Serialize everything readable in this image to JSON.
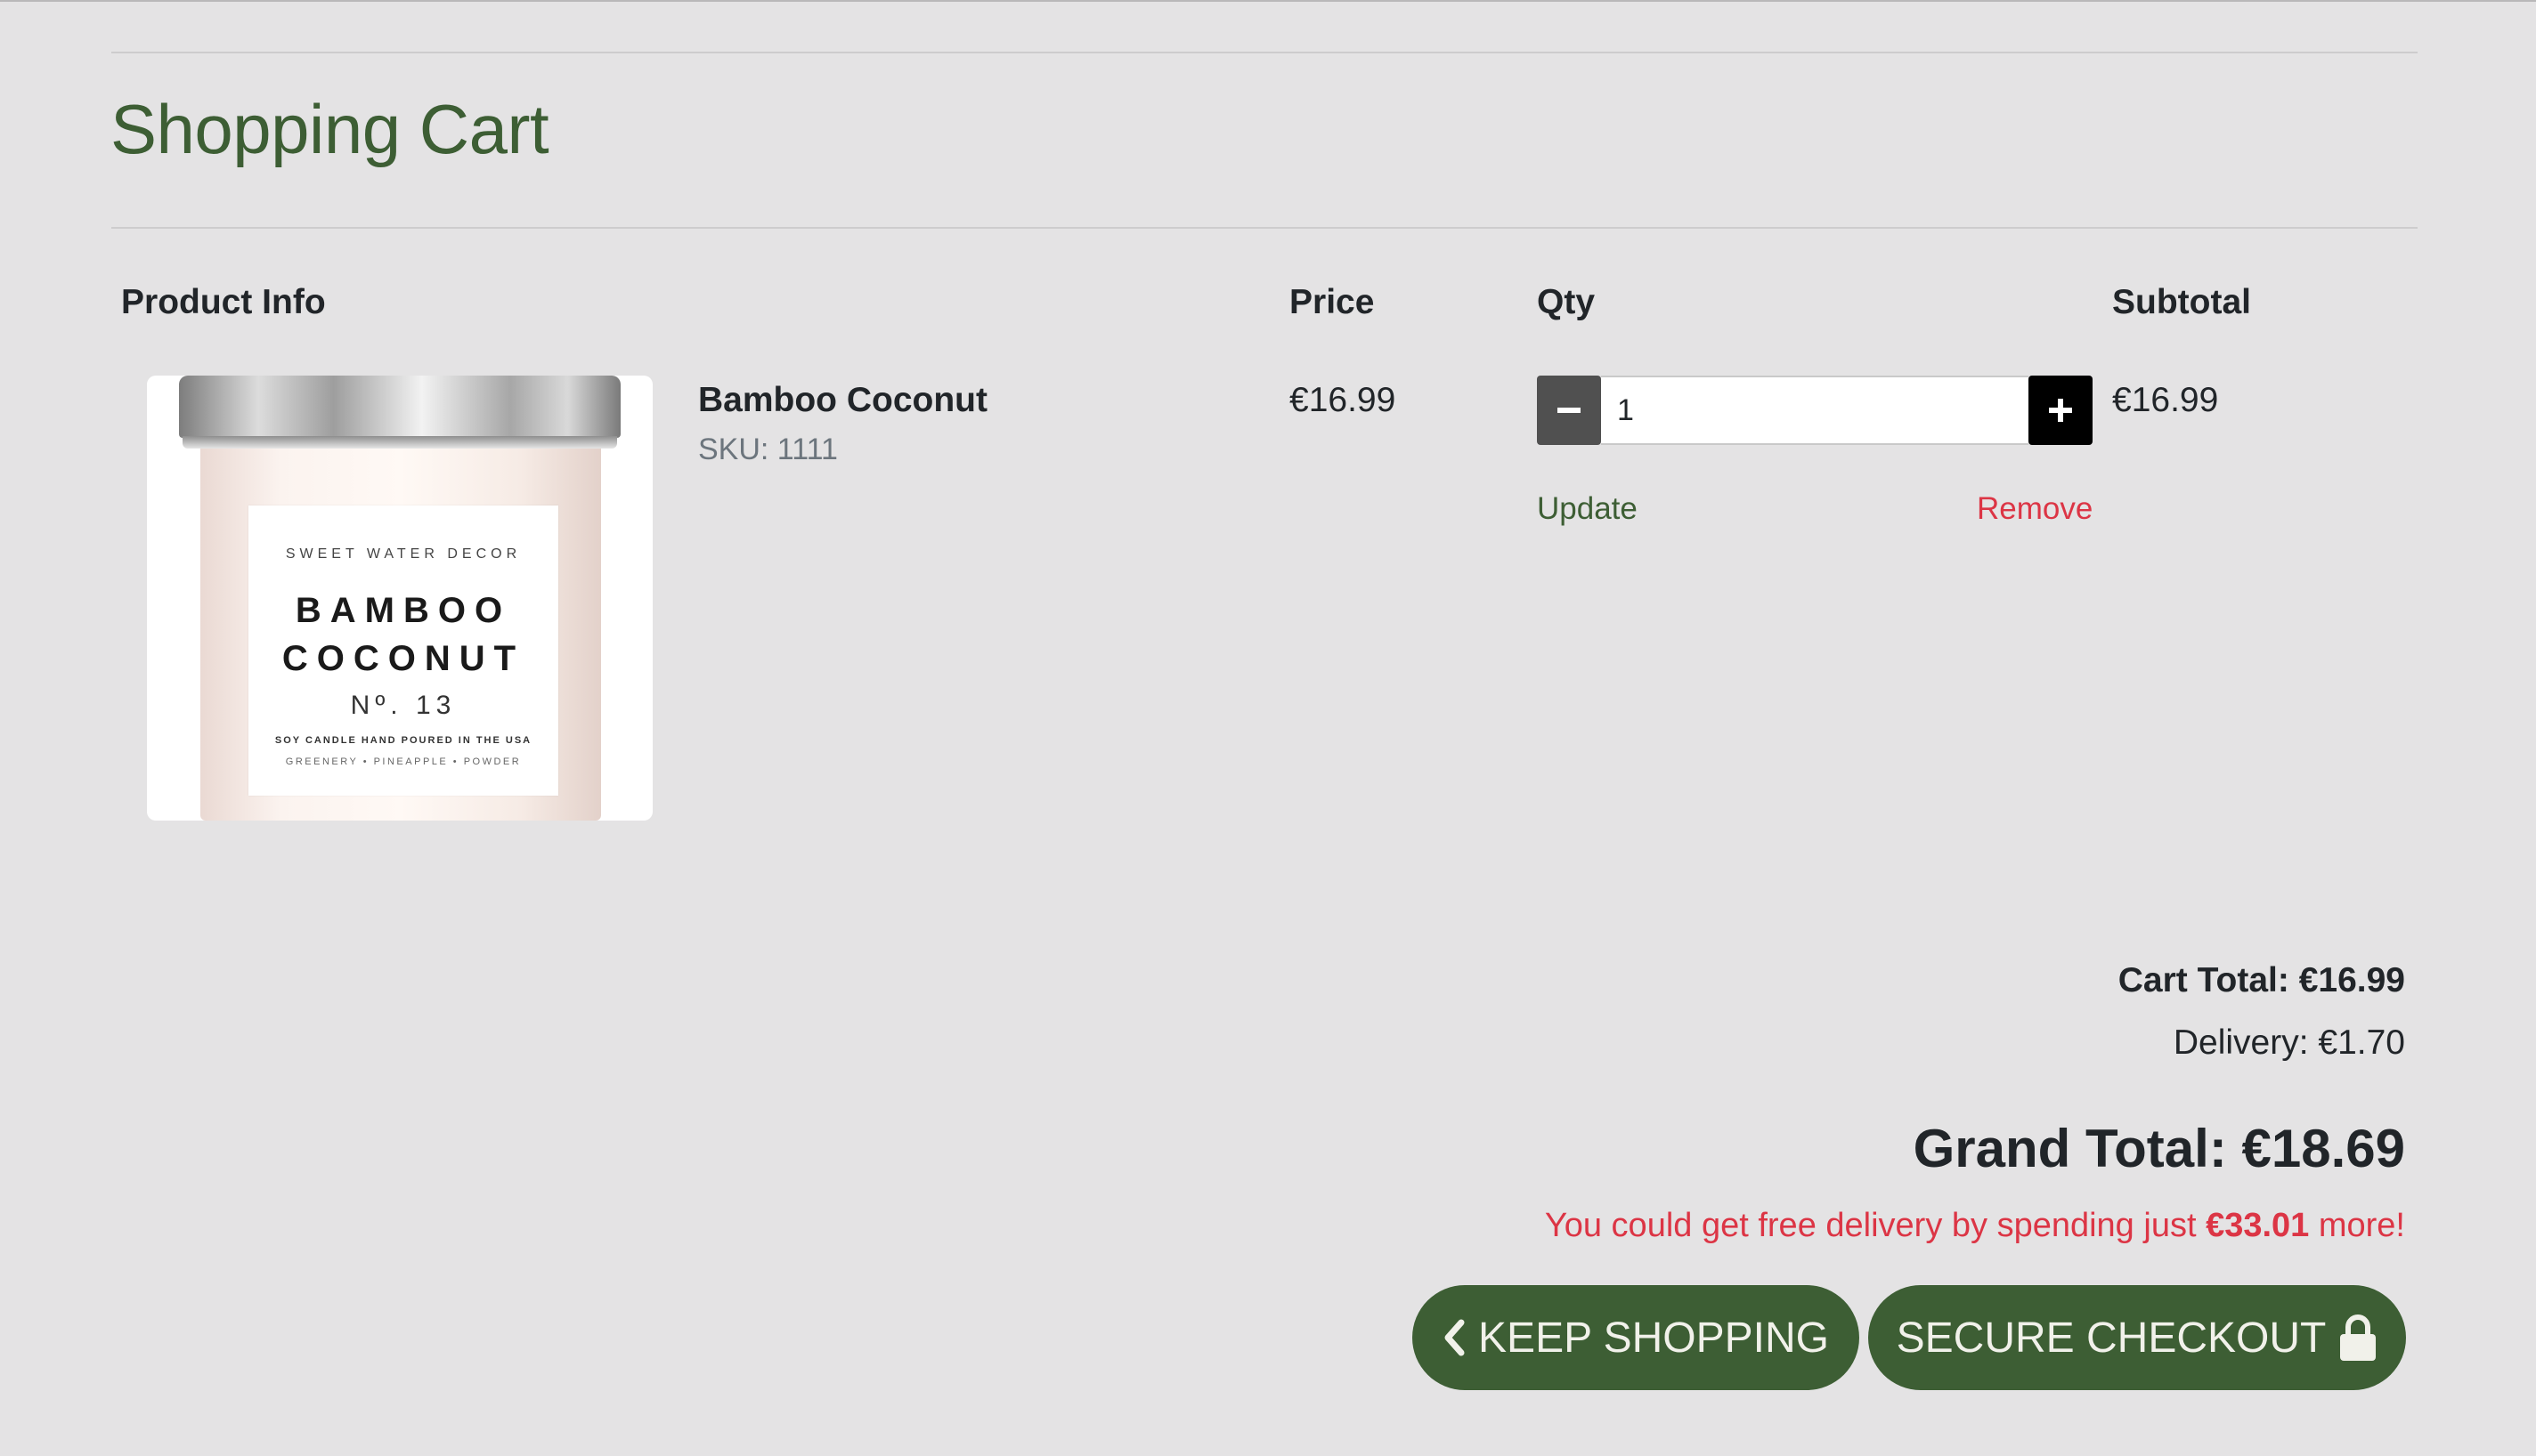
{
  "page": {
    "title": "Shopping Cart"
  },
  "table": {
    "headers": {
      "product_info": "Product Info",
      "price": "Price",
      "qty": "Qty",
      "subtotal": "Subtotal"
    }
  },
  "item": {
    "name": "Bamboo Coconut",
    "sku": "SKU: 1111",
    "price": "€16.99",
    "quantity": "1",
    "subtotal": "€16.99",
    "update_label": "Update",
    "remove_label": "Remove",
    "image": {
      "brand": "SWEET WATER DECOR",
      "name_line1": "BAMBOO",
      "name_line2": "COCONUT",
      "number": "Nº. 13",
      "line1": "SOY CANDLE HAND POURED IN THE USA",
      "line2": "GREENERY • PINEAPPLE • POWDER"
    }
  },
  "qty_controls": {
    "minus_icon": "minus-icon",
    "plus_icon": "plus-icon"
  },
  "totals": {
    "cart_total": "Cart Total: €16.99",
    "delivery": "Delivery: €1.70",
    "grand_total": "Grand Total: €18.69",
    "free_delivery_prefix": "You could get free delivery by spending just ",
    "free_delivery_amount": "€33.01",
    "free_delivery_suffix": " more!"
  },
  "buttons": {
    "keep_shopping": "KEEP SHOPPING",
    "secure_checkout": "SECURE CHECKOUT",
    "keep_icon": "chevron-left-icon",
    "secure_icon": "lock-icon"
  },
  "colors": {
    "brand_green": "#3d5e34",
    "danger_red": "#dc3545",
    "background": "#e4e3e4"
  }
}
